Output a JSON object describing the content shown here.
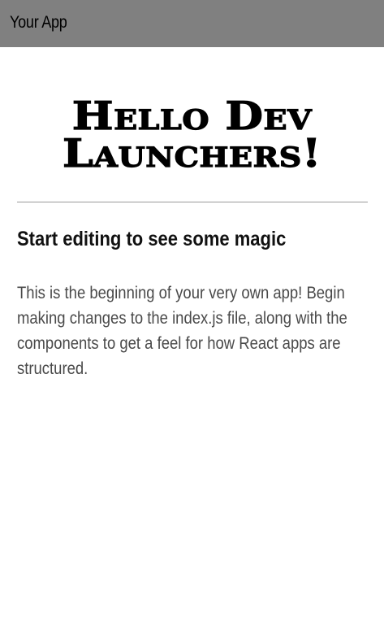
{
  "app_bar": {
    "title": "Your App",
    "background_color": "#808080"
  },
  "main": {
    "hero_title": "Hello Dev Launchers!",
    "subheading": "Start editing to see some magic",
    "description": "This is the beginning of your very own app! Begin making changes to the index.js file, along with the components to get a feel for how React apps are structured."
  }
}
